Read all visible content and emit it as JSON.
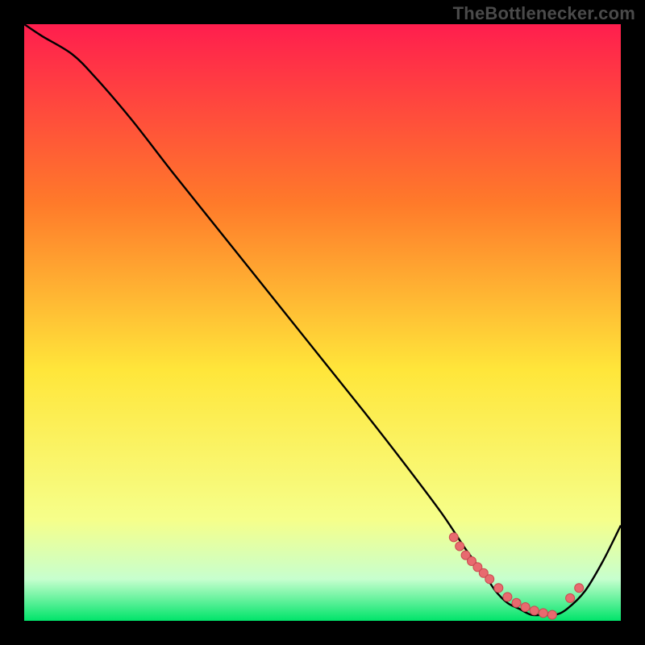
{
  "watermark": "TheBottlenecker.com",
  "colors": {
    "gradient_top": "#ff1e4e",
    "gradient_mid_upper": "#ff7a2a",
    "gradient_mid": "#ffe63a",
    "gradient_lower": "#f6ff8a",
    "gradient_bottom_band": "#c7ffce",
    "gradient_bottom": "#00e46a",
    "curve": "#000000",
    "marker_fill": "#e86a6f",
    "marker_stroke": "#c94a50"
  },
  "chart_data": {
    "type": "line",
    "title": "",
    "xlabel": "",
    "ylabel": "",
    "xlim": [
      0,
      100
    ],
    "ylim": [
      0,
      100
    ],
    "series": [
      {
        "name": "bottleneck-curve",
        "x": [
          0,
          3,
          8,
          12,
          18,
          25,
          33,
          41,
          49,
          57,
          64,
          70,
          74,
          77,
          79,
          81,
          83,
          85,
          87,
          89,
          91,
          94,
          97,
          100
        ],
        "y": [
          100,
          98,
          95,
          91,
          84,
          75,
          65,
          55,
          45,
          35,
          26,
          18,
          12,
          8,
          5,
          3,
          2,
          1,
          1,
          1,
          2,
          5,
          10,
          16
        ]
      }
    ],
    "markers": [
      {
        "series": "bottleneck-curve",
        "points_x": [
          72,
          73,
          74,
          75,
          76,
          77,
          78,
          79.5,
          81,
          82.5,
          84,
          85.5,
          87,
          88.5,
          91.5,
          93
        ],
        "points_y": [
          14,
          12.5,
          11,
          10,
          9,
          8,
          7,
          5.5,
          4,
          3,
          2.3,
          1.7,
          1.3,
          1.0,
          3.8,
          5.5
        ]
      }
    ]
  }
}
